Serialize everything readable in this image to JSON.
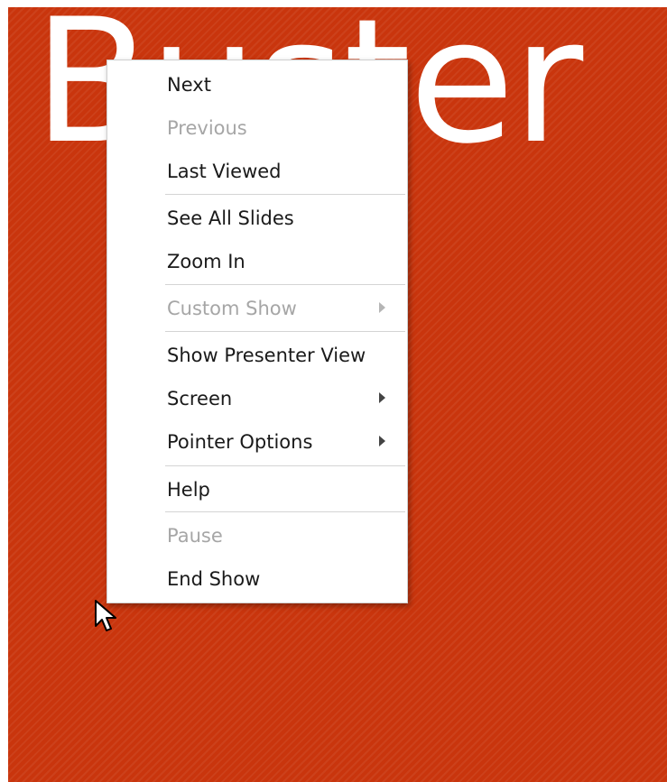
{
  "slide": {
    "title": "Buster"
  },
  "context_menu": {
    "items": [
      {
        "label": "Next",
        "enabled": true,
        "submenu": false
      },
      {
        "label": "Previous",
        "enabled": false,
        "submenu": false
      },
      {
        "label": "Last Viewed",
        "enabled": true,
        "submenu": false
      },
      {
        "label": "See All Slides",
        "enabled": true,
        "submenu": false
      },
      {
        "label": "Zoom In",
        "enabled": true,
        "submenu": false
      },
      {
        "label": "Custom Show",
        "enabled": false,
        "submenu": true
      },
      {
        "label": "Show Presenter View",
        "enabled": true,
        "submenu": false
      },
      {
        "label": "Screen",
        "enabled": true,
        "submenu": true
      },
      {
        "label": "Pointer Options",
        "enabled": true,
        "submenu": true
      },
      {
        "label": "Help",
        "enabled": true,
        "submenu": false
      },
      {
        "label": "Pause",
        "enabled": false,
        "submenu": false
      },
      {
        "label": "End Show",
        "enabled": true,
        "submenu": false
      }
    ]
  },
  "colors": {
    "slide_background": "#c9350d",
    "menu_background": "#ffffff",
    "enabled_text": "#1a1a1a",
    "disabled_text": "#a6a6a6"
  },
  "icons": [
    "submenu-arrow-icon",
    "mouse-cursor-icon"
  ]
}
